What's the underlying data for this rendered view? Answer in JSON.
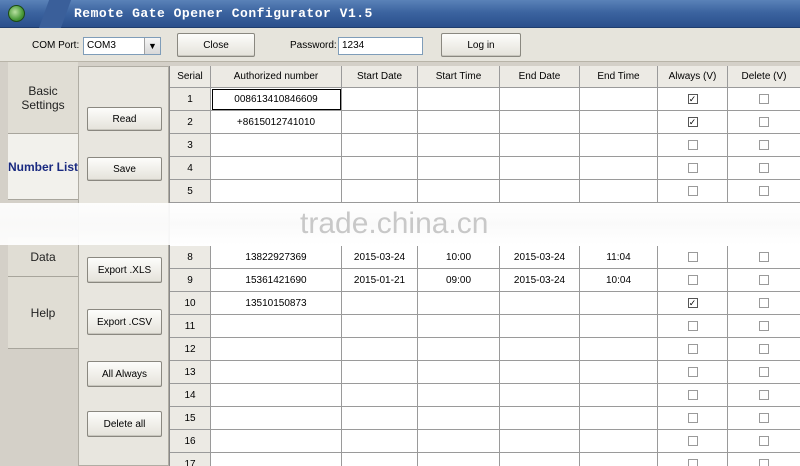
{
  "window": {
    "title": "Remote Gate Opener Configurator V1.5"
  },
  "toolbar": {
    "com_label": "COM Port:",
    "com_value": "COM3",
    "close_label": "Close",
    "password_label": "Password:",
    "password_value": "1234",
    "login_label": "Log in"
  },
  "tabs": [
    "Basic Settings",
    "Number List",
    "Data",
    "Help"
  ],
  "actions": {
    "read": "Read",
    "save": "Save",
    "export_xls": "Export .XLS",
    "export_csv": "Export .CSV",
    "all_always": "All Always",
    "delete_all": "Delete all"
  },
  "table": {
    "columns": [
      "Serial",
      "Authorized number",
      "Start Date",
      "Start Time",
      "End Date",
      "End Time",
      "Always (V)",
      "Delete (V)"
    ],
    "rows": [
      {
        "serial": "1",
        "number": "008613410846609",
        "start_date": "",
        "start_time": "",
        "end_date": "",
        "end_time": "",
        "always": true,
        "delete": false
      },
      {
        "serial": "2",
        "number": "+8615012741010",
        "start_date": "",
        "start_time": "",
        "end_date": "",
        "end_time": "",
        "always": true,
        "delete": false
      },
      {
        "serial": "3",
        "number": "",
        "start_date": "",
        "start_time": "",
        "end_date": "",
        "end_time": "",
        "always": false,
        "delete": false
      },
      {
        "serial": "4",
        "number": "",
        "start_date": "",
        "start_time": "",
        "end_date": "",
        "end_time": "",
        "always": false,
        "delete": false
      },
      {
        "serial": "5",
        "number": "",
        "start_date": "",
        "start_time": "",
        "end_date": "",
        "end_time": "",
        "always": false,
        "delete": false
      },
      {
        "serial": "8",
        "number": "13822927369",
        "start_date": "2015-03-24",
        "start_time": "10:00",
        "end_date": "2015-03-24",
        "end_time": "11:04",
        "always": false,
        "delete": false
      },
      {
        "serial": "9",
        "number": "15361421690",
        "start_date": "2015-01-21",
        "start_time": "09:00",
        "end_date": "2015-03-24",
        "end_time": "10:04",
        "always": false,
        "delete": false
      },
      {
        "serial": "10",
        "number": "13510150873",
        "start_date": "",
        "start_time": "",
        "end_date": "",
        "end_time": "",
        "always": true,
        "delete": false
      },
      {
        "serial": "11",
        "number": "",
        "start_date": "",
        "start_time": "",
        "end_date": "",
        "end_time": "",
        "always": false,
        "delete": false
      },
      {
        "serial": "12",
        "number": "",
        "start_date": "",
        "start_time": "",
        "end_date": "",
        "end_time": "",
        "always": false,
        "delete": false
      },
      {
        "serial": "13",
        "number": "",
        "start_date": "",
        "start_time": "",
        "end_date": "",
        "end_time": "",
        "always": false,
        "delete": false
      },
      {
        "serial": "14",
        "number": "",
        "start_date": "",
        "start_time": "",
        "end_date": "",
        "end_time": "",
        "always": false,
        "delete": false
      },
      {
        "serial": "15",
        "number": "",
        "start_date": "",
        "start_time": "",
        "end_date": "",
        "end_time": "",
        "always": false,
        "delete": false
      },
      {
        "serial": "16",
        "number": "",
        "start_date": "",
        "start_time": "",
        "end_date": "",
        "end_time": "",
        "always": false,
        "delete": false
      },
      {
        "serial": "17",
        "number": "",
        "start_date": "",
        "start_time": "",
        "end_date": "",
        "end_time": "",
        "always": false,
        "delete": false
      }
    ]
  },
  "watermark": "trade.china.cn"
}
